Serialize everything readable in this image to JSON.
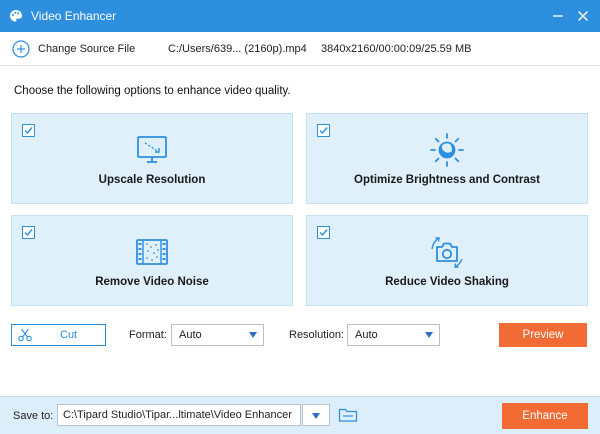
{
  "window": {
    "title": "Video Enhancer",
    "icons": {
      "app": "palette-icon",
      "minimize": "minimize-icon",
      "close": "close-icon"
    },
    "accent_color": "#2e8fdf"
  },
  "source": {
    "change_label": "Change Source File",
    "path": "C:/Users/639... (2160p).mp4",
    "meta": "3840x2160/00:00:09/25.59 MB"
  },
  "intro": "Choose the following options to enhance video quality.",
  "options": [
    {
      "label": "Upscale Resolution",
      "checked": true,
      "icon": "upscale-monitor-icon"
    },
    {
      "label": "Optimize Brightness and Contrast",
      "checked": true,
      "icon": "brightness-sun-icon"
    },
    {
      "label": "Remove Video Noise",
      "checked": true,
      "icon": "film-noise-icon"
    },
    {
      "label": "Reduce Video Shaking",
      "checked": true,
      "icon": "stabilize-camera-icon"
    }
  ],
  "controls": {
    "cut_label": "Cut",
    "format_label": "Format:",
    "format_value": "Auto",
    "resolution_label": "Resolution:",
    "resolution_value": "Auto",
    "preview_label": "Preview"
  },
  "footer": {
    "save_label": "Save to:",
    "save_path": "C:\\Tipard Studio\\Tipar...ltimate\\Video Enhancer",
    "enhance_label": "Enhance"
  },
  "colors": {
    "card_bg": "#dff0fb",
    "orange": "#f26b35",
    "footer_bg": "#dceefa"
  }
}
